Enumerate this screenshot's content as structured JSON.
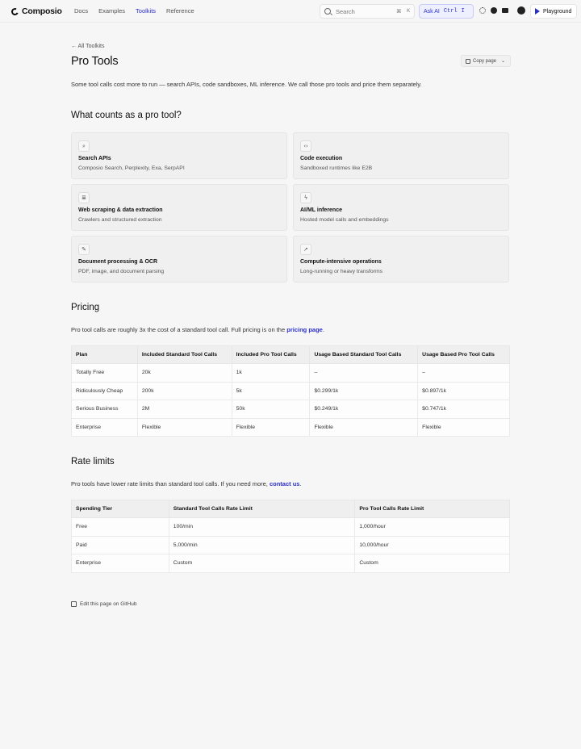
{
  "header": {
    "brand": "Composio",
    "nav": [
      {
        "label": "Docs",
        "active": false
      },
      {
        "label": "Examples",
        "active": false
      },
      {
        "label": "Toolkits",
        "active": true
      },
      {
        "label": "Reference",
        "active": false
      }
    ],
    "search_placeholder": "Search",
    "search_kbd_1": "⌘",
    "search_kbd_2": "K",
    "ask_ai": "Ask AI",
    "ask_ai_kbd_1": "Ctrl",
    "ask_ai_kbd_2": "I",
    "playground": "Playground",
    "accent_color": "#2b30c9"
  },
  "page": {
    "breadcrumb": "← All Toolkits",
    "title": "Pro Tools",
    "copy_button": "Copy page",
    "intro": "Some tool calls cost more to run — search APIs, code sandboxes, ML inference. We call those pro tools and price them separately."
  },
  "section1": {
    "heading": "What counts as a pro tool?",
    "cards": [
      {
        "icon": "search-icon",
        "glyph": "⌕",
        "title": "Search APIs",
        "desc": "Composio Search, Perplexity, Exa, SerpAPI"
      },
      {
        "icon": "code-icon",
        "glyph": "‹›",
        "title": "Code execution",
        "desc": "Sandboxed runtimes like E2B"
      },
      {
        "icon": "database-icon",
        "glyph": "≣",
        "title": "Web scraping & data extraction",
        "desc": "Crawlers and structured extraction"
      },
      {
        "icon": "lightning-icon",
        "glyph": "ϟ",
        "title": "AI/ML inference",
        "desc": "Hosted model calls and embeddings"
      },
      {
        "icon": "wrench-icon",
        "glyph": "✎",
        "title": "Document processing & OCR",
        "desc": "PDF, image, and document parsing"
      },
      {
        "icon": "rocket-icon",
        "glyph": "➚",
        "title": "Compute-intensive operations",
        "desc": "Long-running or heavy transforms"
      }
    ]
  },
  "pricing": {
    "heading": "Pricing",
    "text_before": "Pro tool calls are roughly 3x the cost of a standard tool call. Full pricing is on the ",
    "link": "pricing page",
    "text_after": ".",
    "columns": [
      "Plan",
      "Included Standard Tool Calls",
      "Included Pro Tool Calls",
      "Usage Based Standard Tool Calls",
      "Usage Based Pro Tool Calls"
    ],
    "rows": [
      [
        "Totally Free",
        "20k",
        "1k",
        "–",
        "–"
      ],
      [
        "Ridiculously Cheap",
        "200k",
        "5k",
        "$0.299/1k",
        "$0.897/1k"
      ],
      [
        "Serious Business",
        "2M",
        "50k",
        "$0.249/1k",
        "$0.747/1k"
      ],
      [
        "Enterprise",
        "Flexible",
        "Flexible",
        "Flexible",
        "Flexible"
      ]
    ]
  },
  "rate_limits": {
    "heading": "Rate limits",
    "text_before": "Pro tools have lower rate limits than standard tool calls. If you need more, ",
    "link": "contact us",
    "text_after": ".",
    "columns": [
      "Spending Tier",
      "Standard Tool Calls Rate Limit",
      "Pro Tool Calls Rate Limit"
    ],
    "rows": [
      [
        "Free",
        "100/min",
        "1,000/hour"
      ],
      [
        "Paid",
        "5,000/min",
        "10,000/hour"
      ],
      [
        "Enterprise",
        "Custom",
        "Custom"
      ]
    ]
  },
  "footer": {
    "edit": "Edit this page on GitHub"
  }
}
